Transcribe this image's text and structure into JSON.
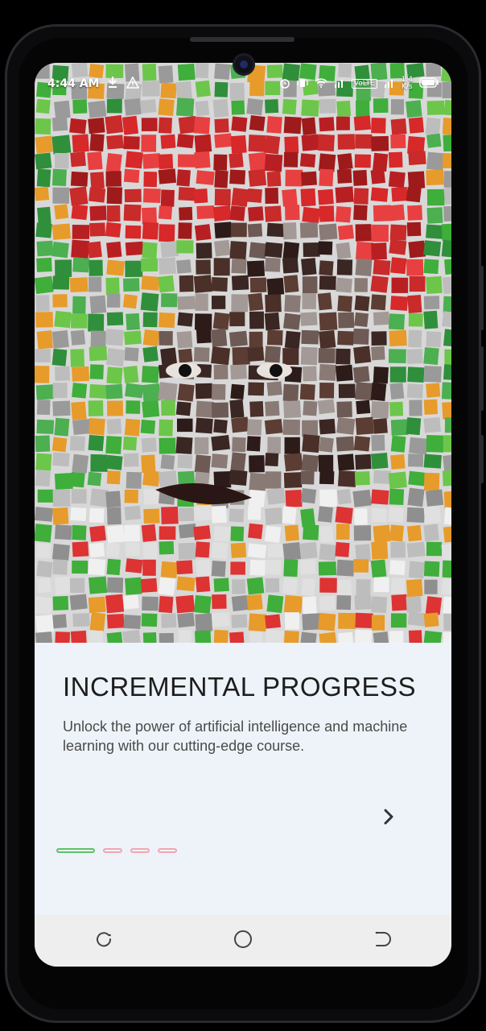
{
  "status_bar": {
    "time": "4:44 AM",
    "left_icons": [
      "download-icon",
      "warning-icon"
    ],
    "right_icons": [
      "alarm-icon",
      "vibrate-icon",
      "wifi-icon",
      "signal-icon",
      "volte-icon",
      "signal-icon"
    ],
    "volte": "VoLTE",
    "net_speed_value": "1.4",
    "net_speed_unit": "K/s"
  },
  "hero": {
    "image_icon": "mosaic-portrait-image",
    "colors": {
      "hat": "#d7282a",
      "skin": "#3a2622",
      "green": "#3fae3b",
      "orange": "#e79b2a",
      "grout": "#d8d8d8"
    }
  },
  "onboarding": {
    "title": "INCREMENTAL PROGRESS",
    "description": "Unlock the power of artificial intelligence and machine learning with our cutting-edge course.",
    "next_icon": "chevron-right-icon",
    "page_indicator": {
      "current": 1,
      "total": 4,
      "active_color": "#5cc26a",
      "inactive_color": "#f1a6b3"
    }
  },
  "nav_bar": {
    "items": [
      "recents-icon",
      "home-icon",
      "back-icon"
    ]
  }
}
